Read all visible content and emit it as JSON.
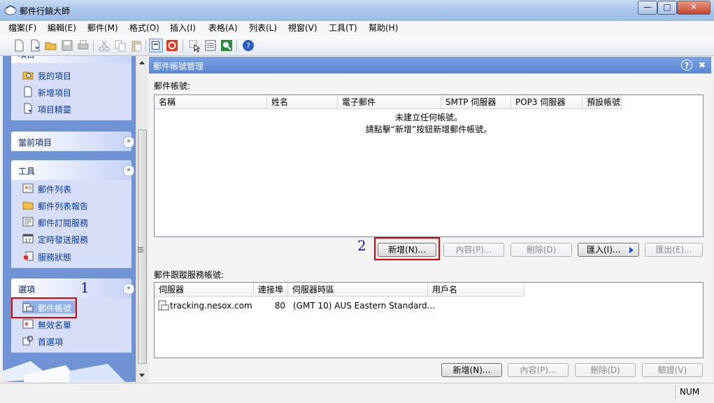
{
  "window": {
    "title": "郵件行銷大師",
    "min_glyph": "—",
    "max_glyph": "□",
    "close_glyph": "✕"
  },
  "menu": [
    "檔案(F)",
    "編輯(E)",
    "郵件(M)",
    "格式(O)",
    "插入(I)",
    "表格(A)",
    "列表(L)",
    "視窗(V)",
    "工具(T)",
    "幫助(H)"
  ],
  "left": {
    "project_group_title": "項目",
    "project_items": [
      "我的項目",
      "新增項目",
      "項目精靈"
    ],
    "current_group_title": "當前項目",
    "tools_group_title": "工具",
    "tools_items": [
      "郵件列表",
      "郵件列表報告",
      "郵件訂閱服務",
      "定時發送服務",
      "服務狀態"
    ],
    "options_group_title": "選項",
    "options_items": [
      "郵件帳號",
      "無效名單",
      "首選項"
    ],
    "collapse_glyph": "«"
  },
  "right": {
    "title": "郵件帳號管理",
    "help_glyph": "?",
    "close_glyph": "✖",
    "accounts_label": "郵件帳號:",
    "accounts_columns": [
      "名稱",
      "姓名",
      "電子郵件",
      "SMTP 伺服器",
      "POP3 伺服器",
      "預設帳號"
    ],
    "empty_line1": "未建立任何帳號。",
    "empty_line2": "請點擊“新增”按鈕新增郵件帳號。",
    "accounts_buttons": {
      "new": "新增(N)...",
      "props": "內容(P)...",
      "delete": "刪除(D)",
      "import": "匯入(I)...",
      "export": "匯出(E)..."
    },
    "tracking_label": "郵件跟蹤服務帳號:",
    "tracking_columns": [
      "伺服器",
      "連接埠",
      "伺服器時區",
      "用戶名"
    ],
    "tracking_rows": [
      {
        "server": "tracking.nesox.com",
        "port": "80",
        "timezone": "(GMT 10) AUS Eastern Standard...",
        "user": ""
      }
    ],
    "tracking_buttons": {
      "new": "新增(N)...",
      "props": "內容(P)...",
      "delete": "刪除(D)",
      "verify": "驗證(V)"
    }
  },
  "annotations": {
    "step1": "1",
    "step2": "2"
  },
  "status": {
    "num": "NUM"
  }
}
